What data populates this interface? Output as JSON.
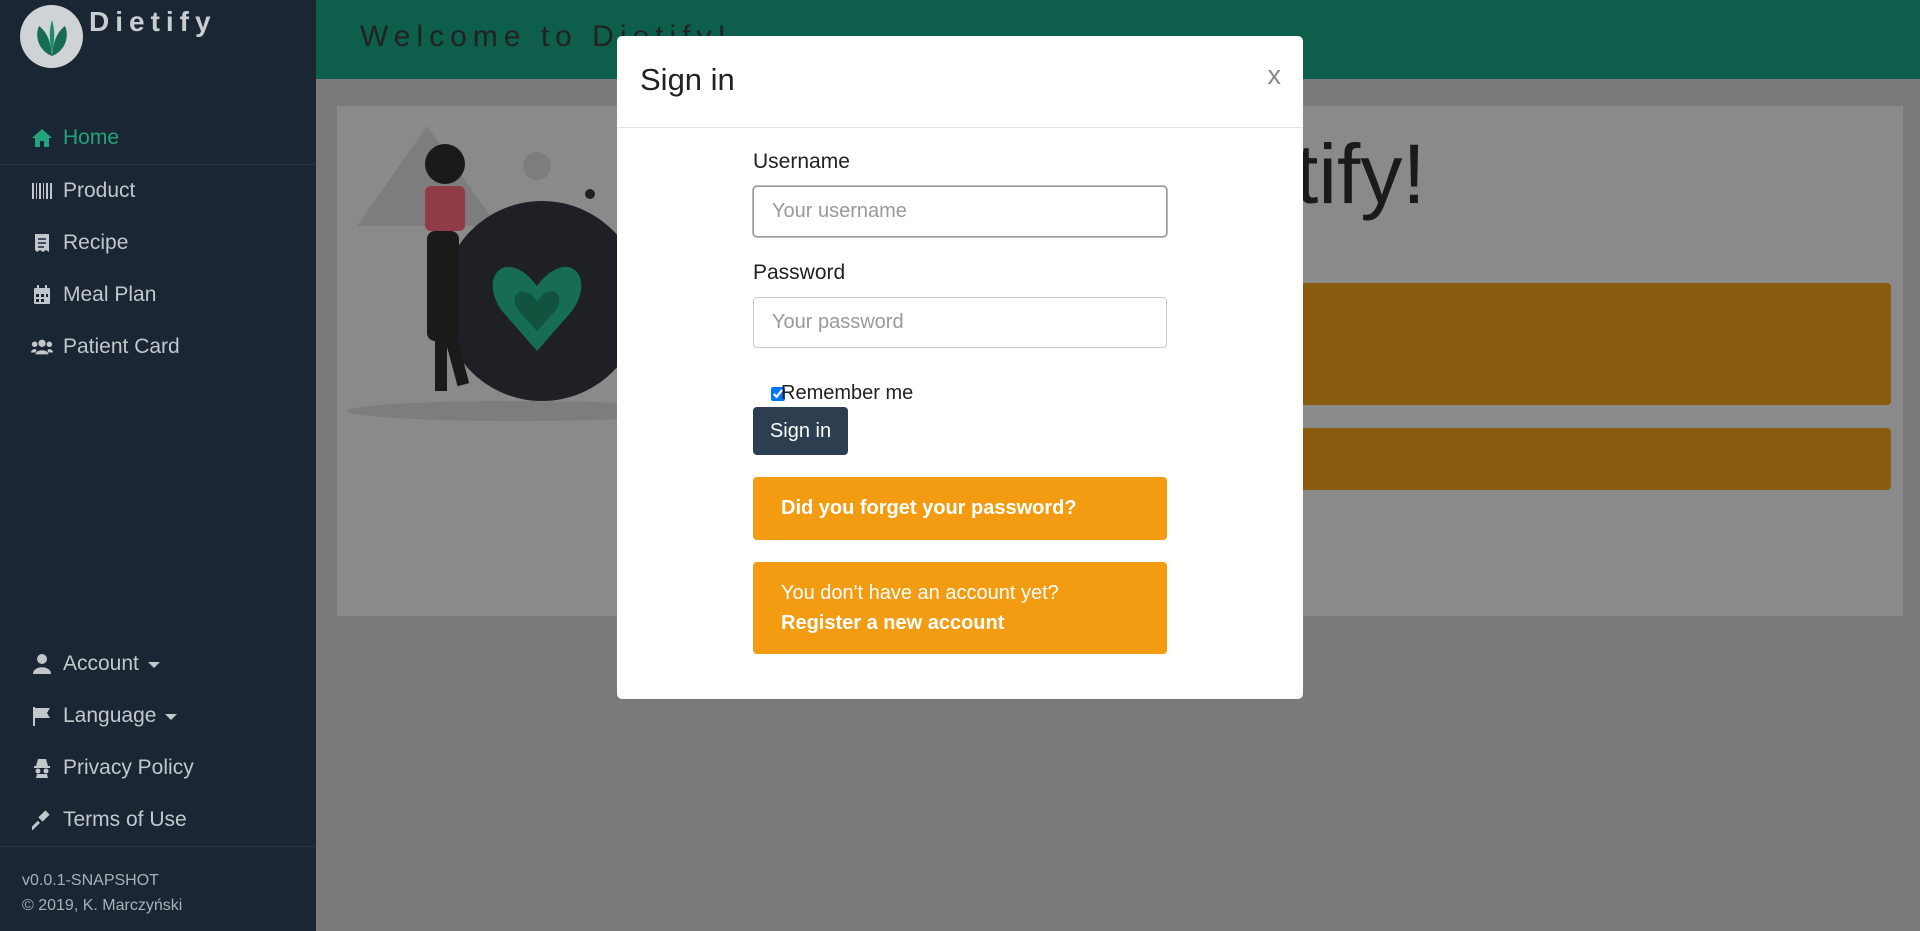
{
  "brand": {
    "name": "Dietify"
  },
  "nav": {
    "items": [
      {
        "label": "Home",
        "icon": "home-icon",
        "active": true
      },
      {
        "label": "Product",
        "icon": "barcode-icon"
      },
      {
        "label": "Recipe",
        "icon": "receipt-icon"
      },
      {
        "label": "Meal Plan",
        "icon": "calendar-icon"
      },
      {
        "label": "Patient Card",
        "icon": "users-icon"
      }
    ],
    "bottom": [
      {
        "label": "Account",
        "icon": "user-icon"
      },
      {
        "label": "Language",
        "icon": "flag-icon"
      },
      {
        "label": "Privacy Policy",
        "icon": "incognito-icon"
      },
      {
        "label": "Terms of Use",
        "icon": "gavel-icon"
      }
    ]
  },
  "footer": {
    "version": "v0.0.1-SNAPSHOT",
    "copyright": "© 2019, K. Marczyński"
  },
  "header": {
    "title": "Welcome to Dietify!"
  },
  "main": {
    "hero_text": "tify!"
  },
  "modal": {
    "title": "Sign in",
    "close_label": "x",
    "username_label": "Username",
    "username_placeholder": "Your username",
    "password_label": "Password",
    "password_placeholder": "Your password",
    "remember_label": "Remember me",
    "remember_checked": true,
    "signin_label": "Sign in",
    "forgot_label": "Did you forget your password?",
    "register_prefix": "You don't have an account yet? ",
    "register_link": "Register a new account"
  },
  "colors": {
    "sidebar": "#1a2634",
    "accent": "#23a37a",
    "warning": "#f39c12",
    "primary": "#2c3e50"
  }
}
